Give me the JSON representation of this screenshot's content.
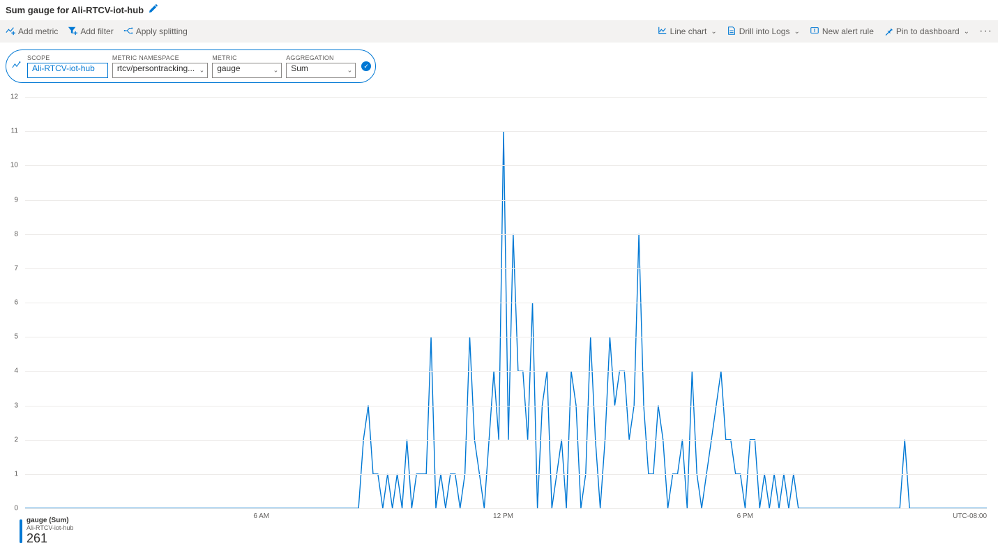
{
  "title": "Sum gauge for Ali-RTCV-iot-hub",
  "toolbar": {
    "add_metric": "Add metric",
    "add_filter": "Add filter",
    "apply_splitting": "Apply splitting",
    "line_chart": "Line chart",
    "drill_logs": "Drill into Logs",
    "new_alert": "New alert rule",
    "pin_dashboard": "Pin to dashboard"
  },
  "params": {
    "scope_label": "SCOPE",
    "scope_value": "Ali-RTCV-iot-hub",
    "namespace_label": "METRIC NAMESPACE",
    "namespace_value": "rtcv/persontracking...",
    "metric_label": "METRIC",
    "metric_value": "gauge",
    "aggregation_label": "AGGREGATION",
    "aggregation_value": "Sum"
  },
  "legend": {
    "series": "gauge (Sum)",
    "resource": "Ali-RTCV-iot-hub",
    "value": "261"
  },
  "chart_data": {
    "type": "line",
    "ylim": [
      0,
      12
    ],
    "y_ticks": [
      0,
      1,
      2,
      3,
      4,
      5,
      6,
      7,
      8,
      9,
      10,
      11,
      12
    ],
    "x_ticks": [
      {
        "label": "6 AM",
        "frac": 0.25
      },
      {
        "label": "12 PM",
        "frac": 0.5
      },
      {
        "label": "6 PM",
        "frac": 0.75
      }
    ],
    "timezone": "UTC-08:00",
    "n_points": 200,
    "values": [
      0,
      0,
      0,
      0,
      0,
      0,
      0,
      0,
      0,
      0,
      0,
      0,
      0,
      0,
      0,
      0,
      0,
      0,
      0,
      0,
      0,
      0,
      0,
      0,
      0,
      0,
      0,
      0,
      0,
      0,
      0,
      0,
      0,
      0,
      0,
      0,
      0,
      0,
      0,
      0,
      0,
      0,
      0,
      0,
      0,
      0,
      0,
      0,
      0,
      0,
      0,
      0,
      0,
      0,
      0,
      0,
      0,
      0,
      0,
      0,
      0,
      0,
      0,
      0,
      0,
      0,
      0,
      0,
      0,
      0,
      2,
      3,
      1,
      1,
      0,
      1,
      0,
      1,
      0,
      2,
      0,
      1,
      1,
      1,
      5,
      0,
      1,
      0,
      1,
      1,
      0,
      1,
      5,
      2,
      1,
      0,
      2,
      4,
      2,
      11,
      2,
      8,
      4,
      4,
      2,
      6,
      0,
      3,
      4,
      0,
      1,
      2,
      0,
      4,
      3,
      0,
      1,
      5,
      2,
      0,
      2,
      5,
      3,
      4,
      4,
      2,
      3,
      8,
      3,
      1,
      1,
      3,
      2,
      0,
      1,
      1,
      2,
      0,
      4,
      1,
      0,
      1,
      2,
      3,
      4,
      2,
      2,
      1,
      1,
      0,
      2,
      2,
      0,
      1,
      0,
      1,
      0,
      1,
      0,
      1,
      0,
      0,
      0,
      0,
      0,
      0,
      0,
      0,
      0,
      0,
      0,
      0,
      0,
      0,
      0,
      0,
      0,
      0,
      0,
      0,
      0,
      0,
      2,
      0,
      0,
      0,
      0,
      0,
      0,
      0,
      0,
      0,
      0,
      0,
      0,
      0,
      0,
      0,
      0,
      0
    ],
    "series_color": "#0078d4"
  }
}
